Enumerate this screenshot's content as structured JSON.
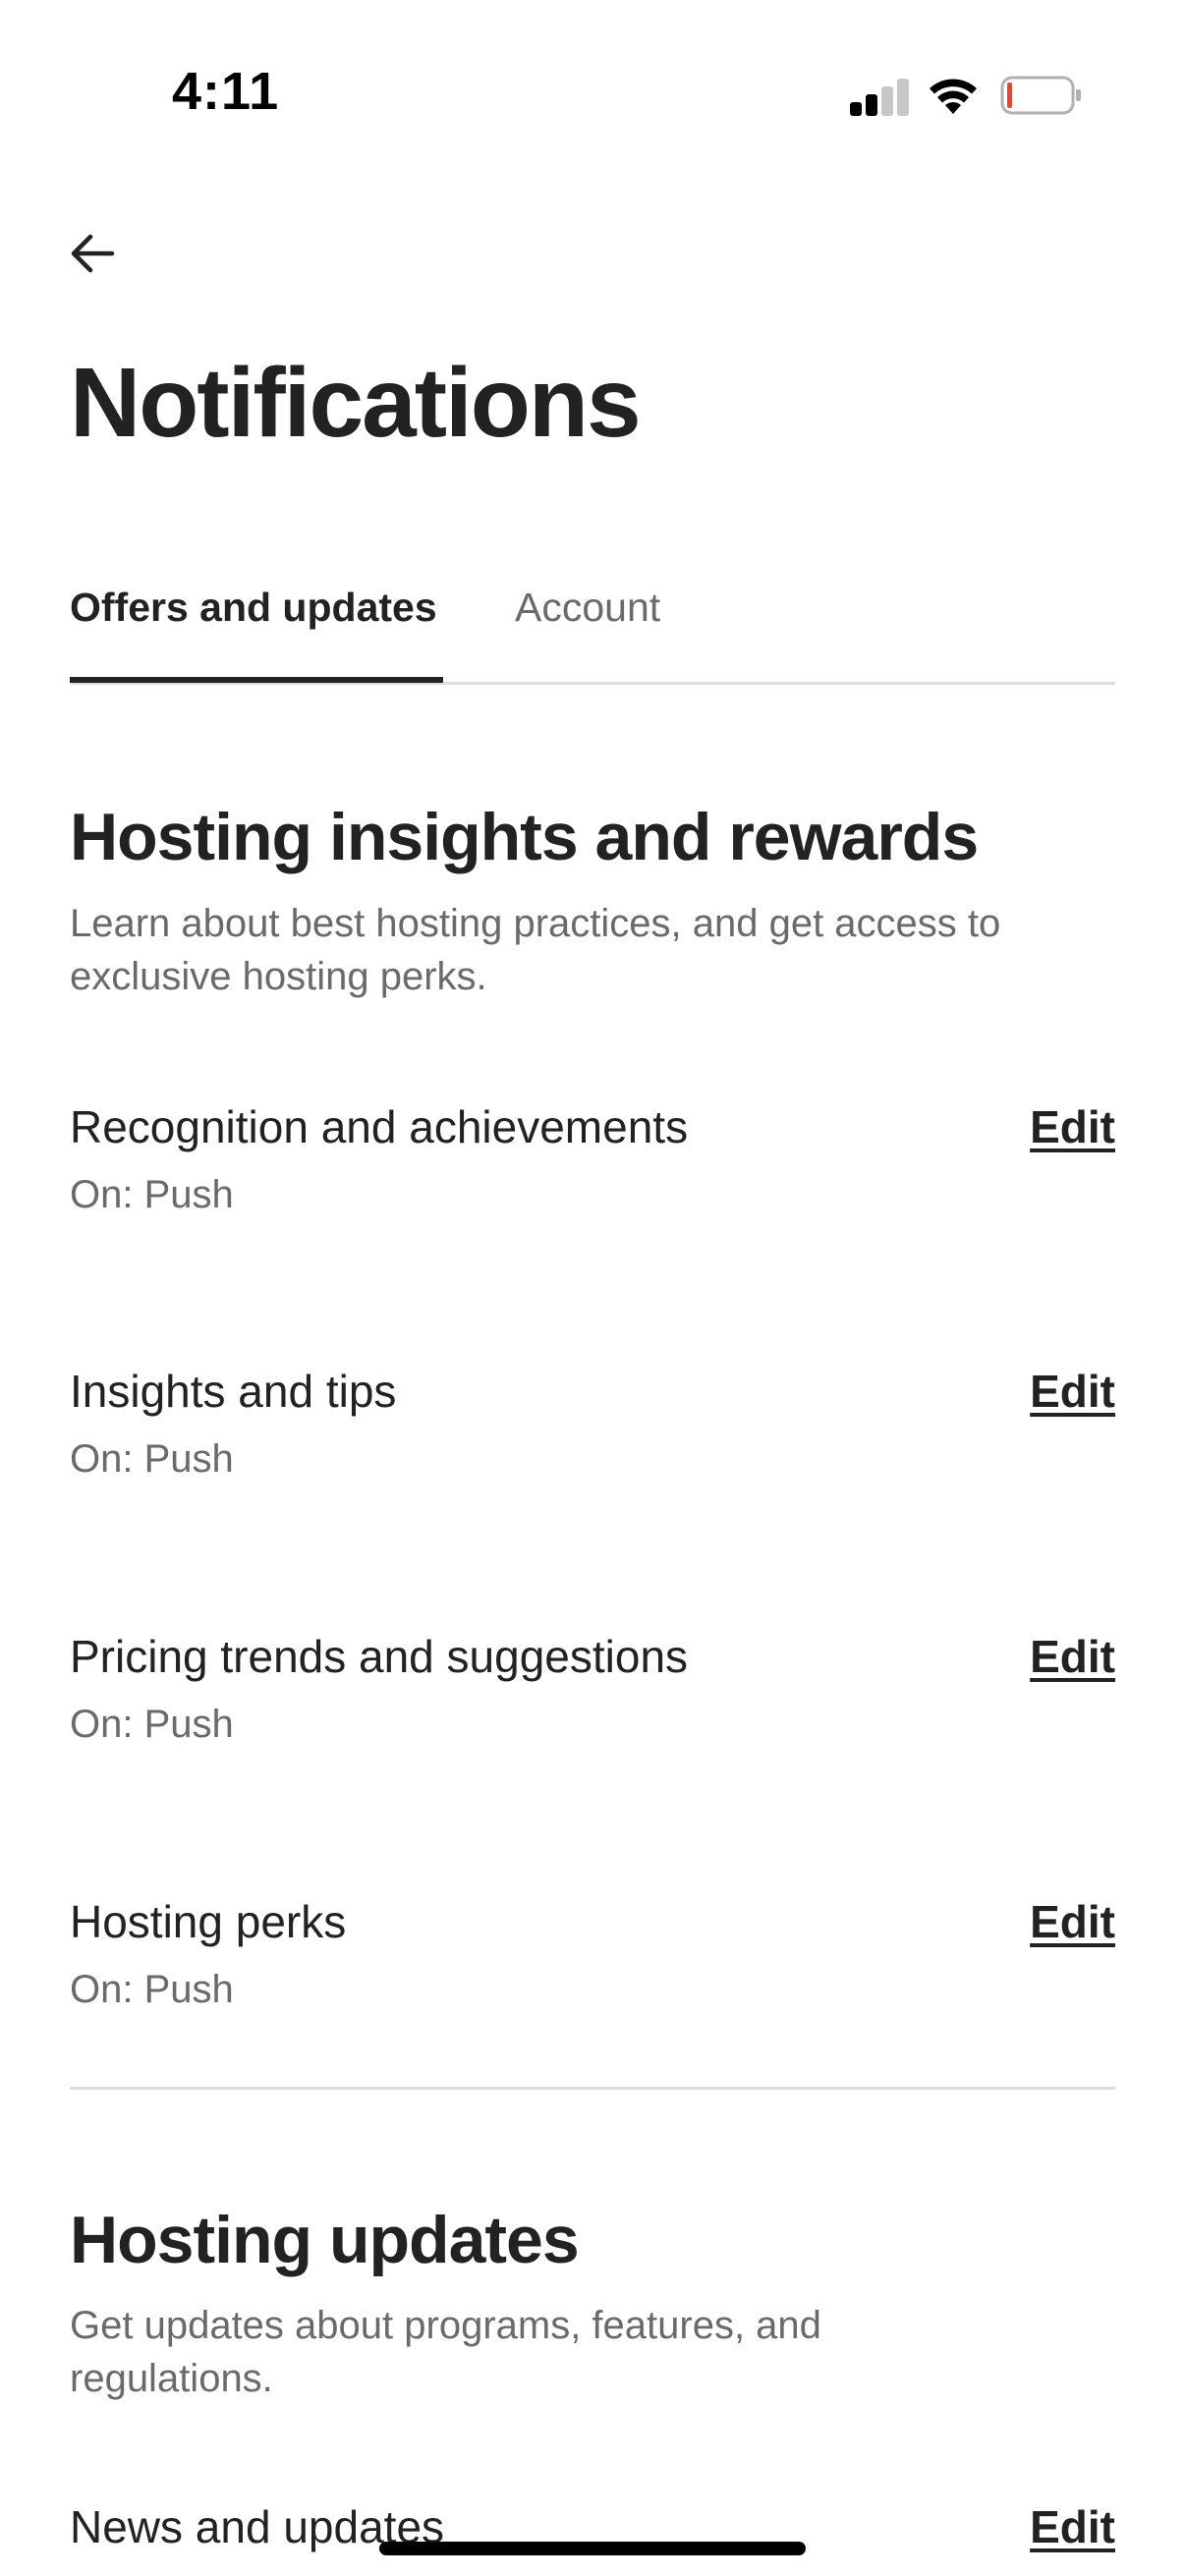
{
  "status_bar": {
    "time": "4:11",
    "battery_color": "#ff3b30"
  },
  "header": {
    "back_icon": "arrow-left-icon",
    "title": "Notifications"
  },
  "tabs": [
    {
      "label": "Offers and updates",
      "active": true
    },
    {
      "label": "Account",
      "active": false
    }
  ],
  "sections": [
    {
      "title": "Hosting insights and rewards",
      "description": "Learn about best hosting practices, and get access to exclusive hosting perks.",
      "items": [
        {
          "label": "Recognition and achievements",
          "status": "On: Push",
          "action": "Edit"
        },
        {
          "label": "Insights and tips",
          "status": "On: Push",
          "action": "Edit"
        },
        {
          "label": "Pricing trends and suggestions",
          "status": "On: Push",
          "action": "Edit"
        },
        {
          "label": "Hosting perks",
          "status": "On: Push",
          "action": "Edit"
        }
      ]
    },
    {
      "title": "Hosting updates",
      "description": "Get updates about programs, features, and regulations.",
      "items": [
        {
          "label": "News and updates",
          "action": "Edit"
        }
      ]
    }
  ]
}
